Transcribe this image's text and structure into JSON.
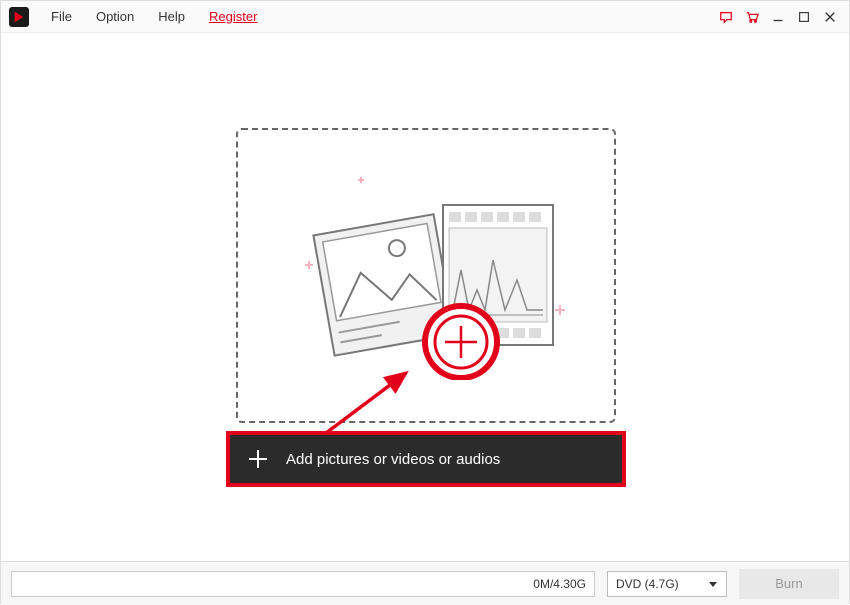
{
  "menubar": {
    "file": "File",
    "option": "Option",
    "help": "Help",
    "register": "Register"
  },
  "main": {
    "add_button_label": "Add pictures or videos or audios"
  },
  "bottombar": {
    "progress_text": "0M/4.30G",
    "disc_type": "DVD (4.7G)",
    "burn_label": "Burn"
  },
  "colors": {
    "accent": "#e2001a"
  }
}
